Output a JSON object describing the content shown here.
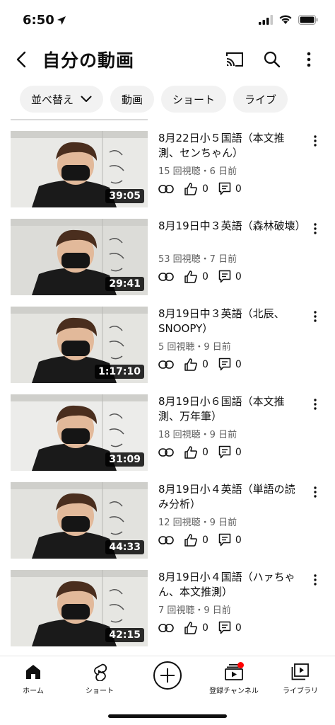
{
  "status": {
    "time": "6:50"
  },
  "header": {
    "title": "自分の動画",
    "icons": [
      "back-arrow-icon",
      "cast-icon",
      "search-icon",
      "more-vert-icon"
    ]
  },
  "chips": [
    {
      "label": "並べ替え"
    },
    {
      "label": "動画"
    },
    {
      "label": "ショート"
    },
    {
      "label": "ライブ"
    }
  ],
  "videos": [
    {
      "title": "8月22日小５国語（本文推測、センちゃん）",
      "meta": "15 回視聴・6 日前",
      "duration": "39:05",
      "likes": "0",
      "comments": "0"
    },
    {
      "title": "8月19日中３英語（森林破壊）",
      "meta": "53 回視聴・7 日前",
      "duration": "29:41",
      "likes": "0",
      "comments": "0"
    },
    {
      "title": "8月19日中３英語（北辰、SNOOPY）",
      "meta": "5 回視聴・9 日前",
      "duration": "1:17:10",
      "likes": "0",
      "comments": "0"
    },
    {
      "title": "8月19日小６国語（本文推測、万年筆）",
      "meta": "18 回視聴・9 日前",
      "duration": "31:09",
      "likes": "0",
      "comments": "0"
    },
    {
      "title": "8月19日小４英語（単語の読み分析）",
      "meta": "12 回視聴・9 日前",
      "duration": "44:33",
      "likes": "0",
      "comments": "0"
    },
    {
      "title": "8月19日小４国語（ハァちゃん、本文推測）",
      "meta": "7 回視聴・9 日前",
      "duration": "42:15",
      "likes": "0",
      "comments": "0"
    }
  ],
  "bottom_nav": {
    "home": "ホーム",
    "shorts": "ショート",
    "subscriptions": "登録チャンネル",
    "library": "ライブラリ"
  },
  "colors": {
    "accent_red": "#ff0000",
    "text": "#0f0f0f",
    "secondary": "#606060",
    "chip_bg": "#f2f2f2"
  }
}
